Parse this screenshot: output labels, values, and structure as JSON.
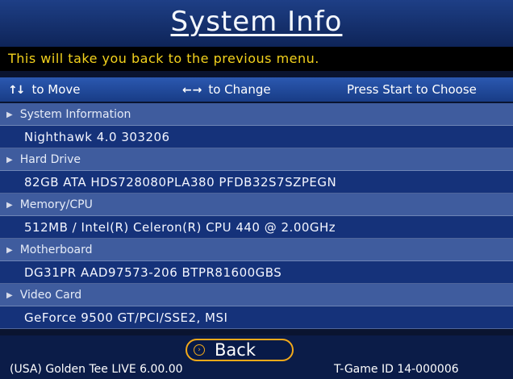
{
  "title": "System Info",
  "message": "This will take you back to the previous menu.",
  "help": {
    "move_arrows": "↑↓",
    "move_label": "to Move",
    "change_arrows": "← →",
    "change_label": "to Change",
    "choose_label": "Press Start to Choose"
  },
  "sections": [
    {
      "header": "System Information",
      "value": "Nighthawk 4.0 303206"
    },
    {
      "header": "Hard Drive",
      "value": "82GB ATA HDS728080PLA380 PFDB32S7SZPEGN"
    },
    {
      "header": "Memory/CPU",
      "value": "512MB / Intel(R) Celeron(R) CPU 440 @ 2.00GHz"
    },
    {
      "header": "Motherboard",
      "value": "DG31PR AAD97573-206 BTPR81600GBS"
    },
    {
      "header": "Video Card",
      "value": "GeForce 9500 GT/PCI/SSE2, MSI"
    }
  ],
  "back_label": "Back",
  "footer": {
    "game": "(USA) Golden Tee LIVE 6.00.00",
    "id": "T-Game ID 14-000006"
  },
  "colors": {
    "message_text": "#f4d21c",
    "button_border": "#f2a91a",
    "header_row": "#3f5c9e",
    "value_row": "#15327a"
  }
}
